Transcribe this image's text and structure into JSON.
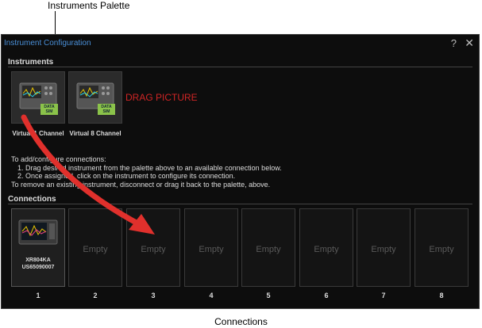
{
  "callouts": {
    "palette": "Instruments Palette",
    "connections": "Connections"
  },
  "window": {
    "title": "Instrument Configuration",
    "help": "?",
    "close": "✕"
  },
  "instruments": {
    "label": "Instruments",
    "items": [
      {
        "label": "Virtual 1 Channel",
        "badge": "DATA SIM"
      },
      {
        "label": "Virtual 8 Channel",
        "badge": "DATA SIM"
      }
    ],
    "drag_hint": "DRAG PICTURE"
  },
  "instructions": {
    "line1": "To add/configure connections:",
    "line2": "1. Drag desired instrument from the palette above to an available connection below.",
    "line3": "2. Once assigned, click on the instrument to configure its connection.",
    "line4": "To remove an existing instrument, disconnect or drag it back to the palette, above."
  },
  "connections": {
    "label": "Connections",
    "slots": [
      {
        "number": "1",
        "model": "XR804KA",
        "serial": "US65090007"
      },
      {
        "number": "2",
        "text": "Empty"
      },
      {
        "number": "3",
        "text": "Empty"
      },
      {
        "number": "4",
        "text": "Empty"
      },
      {
        "number": "5",
        "text": "Empty"
      },
      {
        "number": "6",
        "text": "Empty"
      },
      {
        "number": "7",
        "text": "Empty"
      },
      {
        "number": "8",
        "text": "Empty"
      }
    ]
  },
  "colors": {
    "accent_title": "#4a90d9",
    "drag_red": "#d02525",
    "background": "#0d0d0d"
  }
}
